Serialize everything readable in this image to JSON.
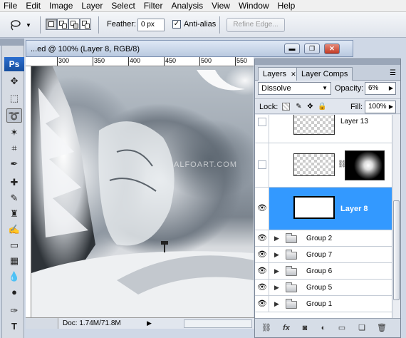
{
  "menu": [
    "File",
    "Edit",
    "Image",
    "Layer",
    "Select",
    "Filter",
    "Analysis",
    "View",
    "Window",
    "Help"
  ],
  "options": {
    "feather_label": "Feather:",
    "feather_value": "0 px",
    "antialias_label": "Anti-alias",
    "antialias_checked": "✓",
    "refine_label": "Refine Edge..."
  },
  "toolbox": {
    "logo": "Ps"
  },
  "document": {
    "title": "...ed @ 100% (Layer 8, RGB/8)",
    "ruler_h": [
      "300",
      "350",
      "400",
      "450",
      "500",
      "550"
    ],
    "watermark": "ALFOART.COM",
    "status": "Doc: 1.74M/71.8M"
  },
  "panel": {
    "tabs": [
      "Layers",
      "Layer Comps"
    ],
    "blend_mode": "Dissolve",
    "opacity_label": "Opacity:",
    "opacity_value": "6%",
    "lock_label": "Lock:",
    "fill_label": "Fill:",
    "fill_value": "100%",
    "layers": [
      {
        "name": "Layer 13",
        "visible": false,
        "type": "layer"
      },
      {
        "name": "",
        "visible": false,
        "type": "masked"
      },
      {
        "name": "Layer 8",
        "visible": true,
        "type": "layer",
        "selected": true
      },
      {
        "name": "Group 2",
        "visible": true,
        "type": "group"
      },
      {
        "name": "Group 7",
        "visible": true,
        "type": "group"
      },
      {
        "name": "Group 6",
        "visible": true,
        "type": "group"
      },
      {
        "name": "Group 5",
        "visible": true,
        "type": "group"
      },
      {
        "name": "Group 1",
        "visible": true,
        "type": "group"
      }
    ]
  },
  "colors": {
    "selection": "#3399ff",
    "ps_logo": "#1f5fb8"
  }
}
